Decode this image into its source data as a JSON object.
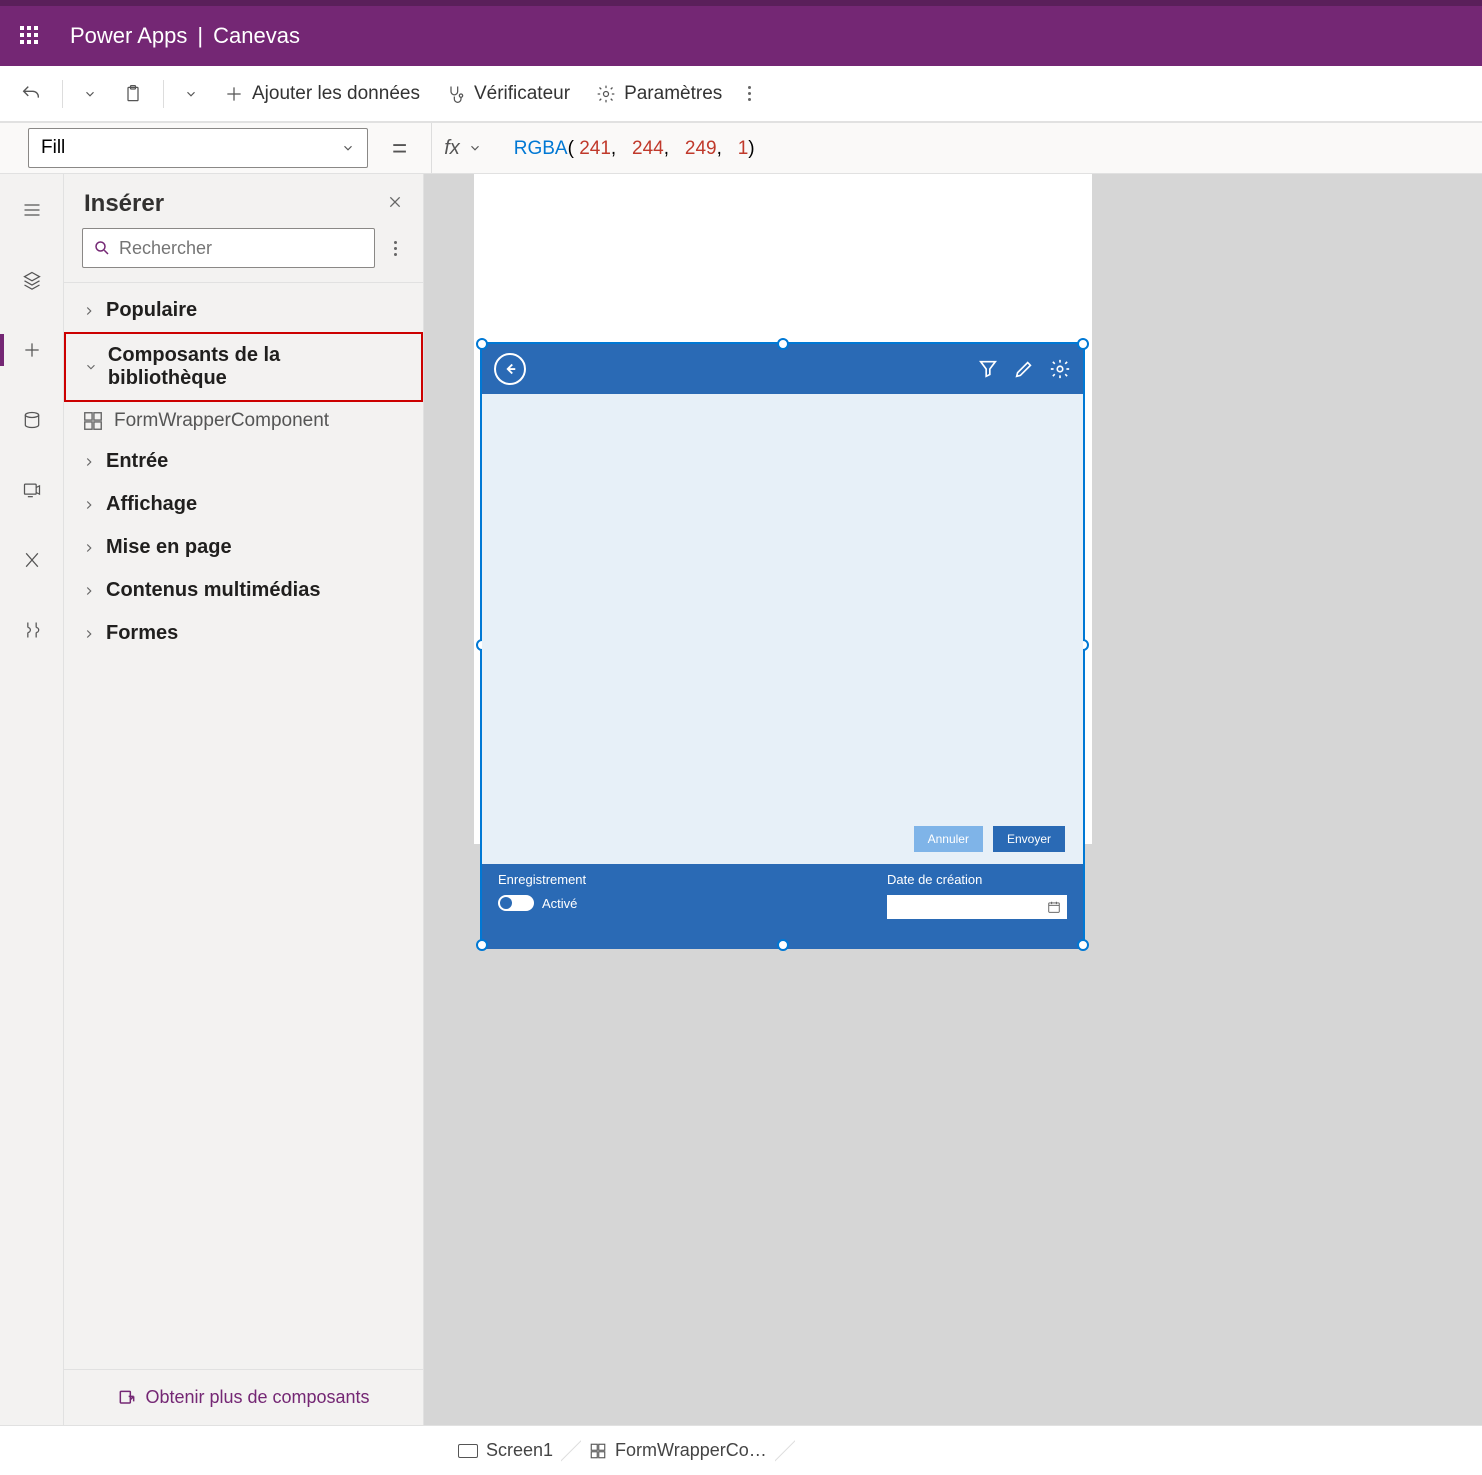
{
  "header": {
    "app": "Power Apps",
    "doc": "Canevas"
  },
  "cmdbar": {
    "add_data": "Ajouter les données",
    "checker": "Vérificateur",
    "settings": "Paramètres"
  },
  "formulabar": {
    "property": "Fill",
    "fn": "RGBA",
    "args": [
      "241",
      "244",
      "249",
      "1"
    ]
  },
  "panel": {
    "title": "Insérer",
    "search_placeholder": "Rechercher",
    "categories": {
      "popular": "Populaire",
      "library": "Composants de la bibliothèque",
      "form_wrapper": "FormWrapperComponent",
      "input": "Entrée",
      "display": "Affichage",
      "layout": "Mise en page",
      "media": "Contenus multimédias",
      "shapes": "Formes"
    },
    "footer_link": "Obtenir plus de composants"
  },
  "component": {
    "cancel": "Annuler",
    "submit": "Envoyer",
    "record_label": "Enregistrement",
    "active_label": "Activé",
    "date_label": "Date de création"
  },
  "breadcrumb": {
    "screen": "Screen1",
    "comp": "FormWrapperCo…"
  }
}
